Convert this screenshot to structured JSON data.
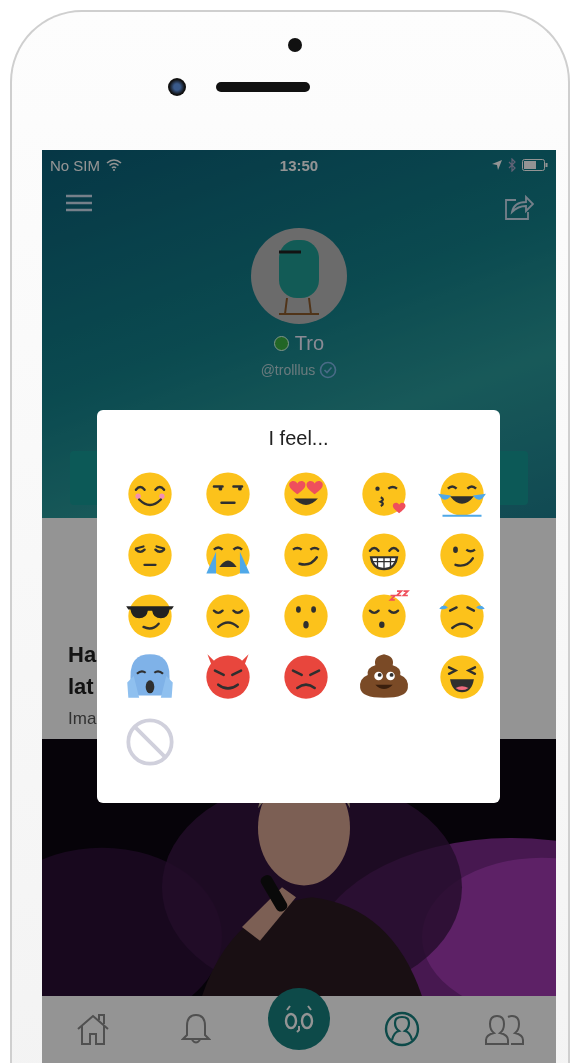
{
  "status_bar": {
    "carrier": "No SIM",
    "time": "13:50"
  },
  "profile": {
    "name": "Tro",
    "online": true,
    "handle": "@trolllus",
    "verified": true
  },
  "post": {
    "title_lines": [
      "Ha",
      "lat"
    ],
    "subtitle": "Ima"
  },
  "emoji_picker": {
    "title": "I feel...",
    "emojis": [
      {
        "kind": "blush"
      },
      {
        "kind": "unamused"
      },
      {
        "kind": "heart-eyes"
      },
      {
        "kind": "kiss"
      },
      {
        "kind": "joy"
      },
      {
        "kind": "pensive"
      },
      {
        "kind": "sob"
      },
      {
        "kind": "smirk"
      },
      {
        "kind": "grin"
      },
      {
        "kind": "wink"
      },
      {
        "kind": "sunglasses"
      },
      {
        "kind": "disappointed"
      },
      {
        "kind": "hushed"
      },
      {
        "kind": "sleepy"
      },
      {
        "kind": "sweat"
      },
      {
        "kind": "scream"
      },
      {
        "kind": "imp"
      },
      {
        "kind": "angry"
      },
      {
        "kind": "poop"
      },
      {
        "kind": "laughing"
      },
      {
        "kind": "none"
      }
    ]
  },
  "bottom_nav": [
    {
      "kind": "home",
      "selected": false
    },
    {
      "kind": "bell",
      "selected": false
    },
    {
      "kind": "center",
      "selected": false
    },
    {
      "kind": "profile",
      "selected": true
    },
    {
      "kind": "people",
      "selected": false
    }
  ]
}
